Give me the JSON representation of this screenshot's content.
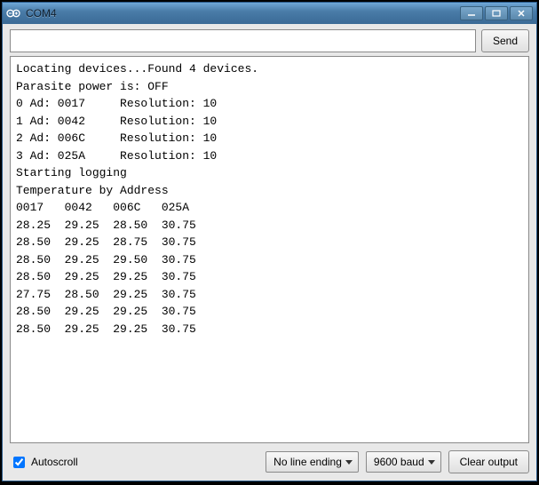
{
  "window": {
    "title": "COM4"
  },
  "toolbar": {
    "send_button": "Send"
  },
  "console_text": "Locating devices...Found 4 devices.\nParasite power is: OFF\n0 Ad: 0017     Resolution: 10\n1 Ad: 0042     Resolution: 10\n2 Ad: 006C     Resolution: 10\n3 Ad: 025A     Resolution: 10\nStarting logging\nTemperature by Address\n0017   0042   006C   025A\n28.25  29.25  28.50  30.75\n28.50  29.25  28.75  30.75\n28.50  29.25  29.50  30.75\n28.50  29.25  29.25  30.75\n27.75  28.50  29.25  30.75\n28.50  29.25  29.25  30.75\n28.50  29.25  29.25  30.75",
  "bottom": {
    "autoscroll_label": "Autoscroll",
    "autoscroll_checked": true,
    "line_ending": "No line ending",
    "baud": "9600 baud",
    "clear_button": "Clear output"
  }
}
